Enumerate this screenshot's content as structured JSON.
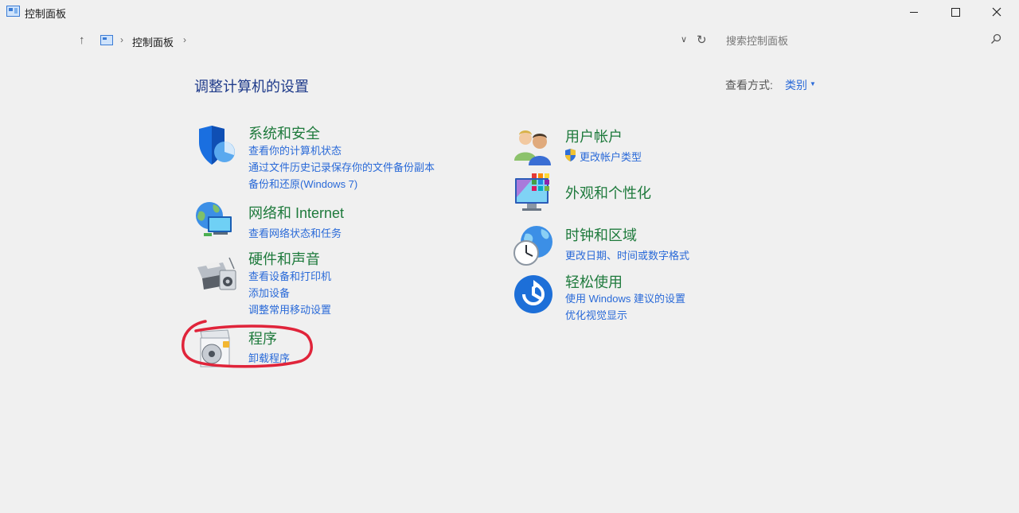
{
  "window": {
    "title": "控制面板"
  },
  "address": {
    "crumb": "控制面板",
    "search_placeholder": "搜索控制面板"
  },
  "header": {
    "title": "调整计算机的设置",
    "view_label": "查看方式:",
    "view_value": "类别"
  },
  "categories": {
    "system": {
      "title": "系统和安全",
      "links": [
        "查看你的计算机状态",
        "通过文件历史记录保存你的文件备份副本",
        "备份和还原(Windows 7)"
      ]
    },
    "network": {
      "title": "网络和 Internet",
      "links": [
        "查看网络状态和任务"
      ]
    },
    "hardware": {
      "title": "硬件和声音",
      "links": [
        "查看设备和打印机",
        "添加设备",
        "调整常用移动设置"
      ]
    },
    "programs": {
      "title": "程序",
      "links": [
        "卸载程序"
      ]
    },
    "users": {
      "title": "用户帐户",
      "links": [
        "更改帐户类型"
      ]
    },
    "appearance": {
      "title": "外观和个性化"
    },
    "clock": {
      "title": "时钟和区域",
      "links": [
        "更改日期、时间或数字格式"
      ]
    },
    "ease": {
      "title": "轻松使用",
      "links": [
        "使用 Windows 建议的设置",
        "优化视觉显示"
      ]
    }
  },
  "colors": {
    "category_title": "#1e7a3c",
    "link": "#2a6ad8",
    "annotation": "#e0243a"
  }
}
